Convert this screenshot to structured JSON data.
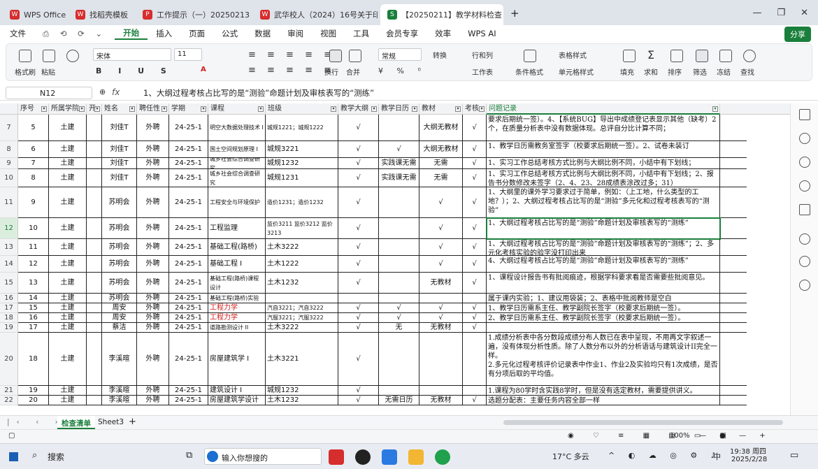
{
  "tabs": [
    {
      "label": "WPS Office",
      "color": "#d62d2d",
      "glyph": "W",
      "active": false
    },
    {
      "label": "找稻壳模板",
      "color": "#d62d2d",
      "glyph": "W",
      "active": false
    },
    {
      "label": "工作提示（一）20250213.pdf",
      "color": "#d62d2d",
      "glyph": "P",
      "active": false
    },
    {
      "label": "武华校人（2024）16号关于印发《证",
      "color": "#d62d2d",
      "glyph": "W",
      "active": false
    },
    {
      "label": "【20250211】教学材料检查",
      "color": "#1a7f3c",
      "glyph": "S",
      "active": true
    }
  ],
  "menu": {
    "file": "文件",
    "items": [
      "开始",
      "插入",
      "页面",
      "公式",
      "数据",
      "审阅",
      "视图",
      "工具",
      "会员专享",
      "效率",
      "WPS AI"
    ],
    "share": "分享"
  },
  "ribbon": {
    "paste": "粘贴",
    "format_painter": "格式刷",
    "font": "宋体",
    "font_size": "11",
    "wrap": "换行",
    "merge": "合并",
    "number_format": "常规",
    "convert": "转换",
    "row_col": "行和列",
    "worksheet": "工作表",
    "table_style": "表格样式",
    "cond_format": "条件格式",
    "cell_style": "单元格样式",
    "fill": "填充",
    "sum": "求和",
    "sort": "排序",
    "filter": "筛选",
    "freeze": "冻结",
    "find": "查找"
  },
  "formula_bar": {
    "cell_ref": "N12",
    "fx": "fx",
    "content": "1、大纲过程考核占比写的是“测验”命题计划及审核表写的“测练”"
  },
  "columns": [
    {
      "letter": "",
      "label": "序号"
    },
    {
      "label": "所属学院"
    },
    {
      "label": "开"
    },
    {
      "label": "姓名"
    },
    {
      "label": "聘任性"
    },
    {
      "label": "学期"
    },
    {
      "label": "课程"
    },
    {
      "label": "班级"
    },
    {
      "label": "教学大纲"
    },
    {
      "label": "教学日历"
    },
    {
      "label": "教材"
    },
    {
      "label": "考核"
    },
    {
      "label": "问题记录"
    }
  ],
  "rows": [
    {
      "rn": "7",
      "id": "5",
      "dept": "土建",
      "name": "刘佳T",
      "type": "外聘",
      "term": "24-25-1",
      "course": "明空大数据处理技术 I",
      "cls": "城规1221；城规1222",
      "a": "√",
      "b": "",
      "c": "大纲无教材",
      "d": "√",
      "note": "要求后期统一签）。4、【系统BUG】导出中成绩登记表显示其他（缺考）2个，在质量分析表中没有数据体现。总评自分比计算不同；"
    },
    {
      "rn": "8",
      "id": "6",
      "dept": "土建",
      "name": "刘佳T",
      "type": "外聘",
      "term": "24-25-1",
      "course": "国土空间规划原理 I",
      "cls": "城规3221",
      "a": "√",
      "b": "√",
      "c": "大纲无教材",
      "d": "√",
      "note": "1、教学日历需教务室签字（校要求后期统一签）。2、试卷未装订"
    },
    {
      "rn": "9",
      "id": "7",
      "dept": "土建",
      "name": "刘佳T",
      "type": "外聘",
      "term": "24-25-1",
      "course": "城乡社会综合调查研究",
      "cls": "城规1232",
      "a": "√",
      "b": "实践课无需",
      "c": "无需",
      "d": "√",
      "note": "1、实习工作总结考核方式比例与大纲比例不同，小结中有下划线；"
    },
    {
      "rn": "10",
      "id": "8",
      "dept": "土建",
      "name": "刘佳T",
      "type": "外聘",
      "term": "24-25-1",
      "course": "城乡社会综合调查研究",
      "cls": "城规1231",
      "a": "√",
      "b": "实践课无需",
      "c": "无需",
      "d": "√",
      "note": "1、实习工作总结考核方式比例与大纲比例不同，小结中有下划线；2、报告书分数修改未签字（2、4、23、28成绩表涂改过多；31）"
    },
    {
      "rn": "11",
      "id": "9",
      "dept": "土建",
      "name": "苏明会",
      "type": "外聘",
      "term": "24-25-1",
      "course": "工程安全与环境保护",
      "cls": "造价1231；造价1232",
      "a": "√",
      "b": "",
      "c": "√",
      "d": "√",
      "note": "1、大纲里的课外学习要求过于简单，例如：（上工地，什么类型的工地？）；2、大纲过程考核占比写的是“测验”多元化和过程考核表写的“测验”"
    },
    {
      "rn": "12",
      "id": "10",
      "dept": "土建",
      "name": "苏明会",
      "type": "外聘",
      "term": "24-25-1",
      "course": "工程监理",
      "cls": "监价3211 监价3212 监价3213",
      "a": "√",
      "b": "",
      "c": "√",
      "d": "√",
      "note": "1、大纲过程考核占比写的是“测验”命题计划及审核表写的“测练”"
    },
    {
      "rn": "13",
      "id": "11",
      "dept": "土建",
      "name": "苏明会",
      "type": "外聘",
      "term": "24-25-1",
      "course": "基础工程(路桥)",
      "cls": "土木3222",
      "a": "√",
      "b": "",
      "c": "√",
      "d": "√",
      "note": "1、大纲过程考核占比写的是“测验”命题计划及审核表写的“测练”；2、多元化考核实验的验字没打印出来"
    },
    {
      "rn": "14",
      "id": "12",
      "dept": "土建",
      "name": "苏明会",
      "type": "外聘",
      "term": "24-25-1",
      "course": "基础工程 I",
      "cls": "土木1222",
      "a": "√",
      "b": "",
      "c": "√",
      "d": "√",
      "note": "4、大纲过程考核占比写的是“测验”命题计划及审核表写的“测练”"
    },
    {
      "rn": "15",
      "id": "13",
      "dept": "土建",
      "name": "苏明会",
      "type": "外聘",
      "term": "24-25-1",
      "course": "基础工程(路桥)课程设计",
      "cls": "土木1232",
      "a": "√",
      "b": "",
      "c": "无教材",
      "d": "√",
      "note": "1、课程设计报告书有批阅痕迹，根据学科要求看是否需要些批阅意见。"
    },
    {
      "rn": "16",
      "id": "14",
      "dept": "土建",
      "name": "苏明会",
      "type": "外聘",
      "term": "24-25-1",
      "course": "基础工程(路桥)实验",
      "cls": "",
      "a": "",
      "b": "",
      "c": "",
      "d": "",
      "note": "属于课内实验；1、建议用袋装；2、表格中批阅教师是空白"
    },
    {
      "rn": "17",
      "id": "15",
      "dept": "土建",
      "name": "周安",
      "type": "外聘",
      "term": "24-25-1",
      "course": "工程力学",
      "cls": "汽自3221；汽自3222",
      "a": "√",
      "b": "√",
      "c": "√",
      "d": "√",
      "note": "1、教学日历需系主任、教学副院长签字（校要求后期统一签）。",
      "red": true
    },
    {
      "rn": "18",
      "id": "16",
      "dept": "土建",
      "name": "周安",
      "type": "外聘",
      "term": "24-25-1",
      "course": "工程力学",
      "cls": "汽服3221；汽服3222",
      "a": "√",
      "b": "√",
      "c": "√",
      "d": "√",
      "note": "2、教学日历需系主任、教学副院长签字（校要求后期统一签）。",
      "red": true
    },
    {
      "rn": "19",
      "id": "17",
      "dept": "土建",
      "name": "蔡洁",
      "type": "外聘",
      "term": "24-25-1",
      "course": "道路勘测设计 II",
      "cls": "土木3222",
      "a": "√",
      "b": "无",
      "c": "无教材",
      "d": "√",
      "note": ""
    },
    {
      "rn": "20",
      "id": "18",
      "dept": "土建",
      "name": "李溪暄",
      "type": "外聘",
      "term": "24-25-1",
      "course": "房屋建筑学 I",
      "cls": "土木3221",
      "a": "√",
      "b": "",
      "c": "",
      "d": "",
      "note": "1.成绩分析表中各分数段成绩分布人数已在表中呈现，不用再文字叙述一遍，没有体现分析性质。除了人数分布以外的分析语话与建筑设计II完全一样。\n2.多元化过程考核评价记录表中作业1、作业2及实验均只有1次成绩，是否有分项后取的平均值。"
    },
    {
      "rn": "21",
      "id": "19",
      "dept": "土建",
      "name": "李溪暄",
      "type": "外聘",
      "term": "24-25-1",
      "course": "建筑设计 I",
      "cls": "城规1232",
      "a": "√",
      "b": "",
      "c": "",
      "d": "",
      "note": "1.课程为80学时含实践8学时，但是没有选定教材，需要提供讲义。"
    },
    {
      "rn": "22",
      "id": "20",
      "dept": "土建",
      "name": "李溪暄",
      "type": "外聘",
      "term": "24-25-1",
      "course": "房屋建筑学设计",
      "cls": "土木1232",
      "a": "√",
      "b": "无需日历",
      "c": "无教材",
      "d": "√",
      "note": "选题分配表：主要任务内容全部一样"
    }
  ],
  "sheets": {
    "active": "检查清单",
    "other": "Sheet3"
  },
  "status": {
    "zoom": "100%"
  },
  "taskbar": {
    "search": "搜索",
    "input_placeholder": "输入你想搜的",
    "weather": "17°C 多云",
    "ime": "中",
    "time": "19:38 周四",
    "date": "2025/2/28"
  }
}
